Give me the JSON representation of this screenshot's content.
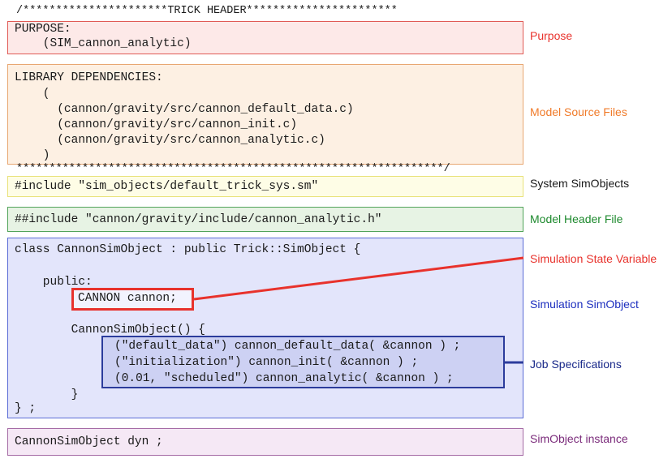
{
  "header_top": "/**********************TRICK HEADER***********************",
  "header_bottom": "*****************************************************************/",
  "purpose_block": {
    "line1": "PURPOSE:",
    "line2": "    (SIM_cannon_analytic)"
  },
  "library_block": {
    "line1": "LIBRARY DEPENDENCIES:",
    "line2": "    (",
    "line3": "      (cannon/gravity/src/cannon_default_data.c)",
    "line4": "      (cannon/gravity/src/cannon_init.c)",
    "line5": "      (cannon/gravity/src/cannon_analytic.c)",
    "line6": "    )"
  },
  "system_include": "#include \"sim_objects/default_trick_sys.sm\"",
  "model_include": "##include \"cannon/gravity/include/cannon_analytic.h\"",
  "class_block": {
    "line1": "class CannonSimObject : public Trick::SimObject {",
    "line2": "    public:",
    "state_var": "CANNON cannon;",
    "line3": "        CannonSimObject() {",
    "job1": "(\"default_data\") cannon_default_data( &cannon ) ;",
    "job2": "(\"initialization\") cannon_init( &cannon ) ;",
    "job3": "(0.01, \"scheduled\") cannon_analytic( &cannon ) ;",
    "line4": "        }",
    "line5": "} ;"
  },
  "instance_line": "CannonSimObject dyn ;",
  "labels": {
    "purpose": "Purpose",
    "model_source": "Model Source Files",
    "system_simobjects": "System SimObjects",
    "model_header": "Model Header File",
    "state_variable": "Simulation State Variable",
    "simulation_simobject": "Simulation SimObject",
    "job_specifications": "Job Specifications",
    "simobject_instance": "SimObject instance"
  },
  "colors": {
    "purpose": "#e8322c",
    "model_source": "#f07b2a",
    "system_simobjects": "#1a1a1a",
    "model_header": "#1e8a2e",
    "state_variable": "#e8322c",
    "simulation_simobject": "#1d2fbf",
    "job_specifications": "#1a2a8a",
    "simobject_instance": "#7a2a7a"
  }
}
